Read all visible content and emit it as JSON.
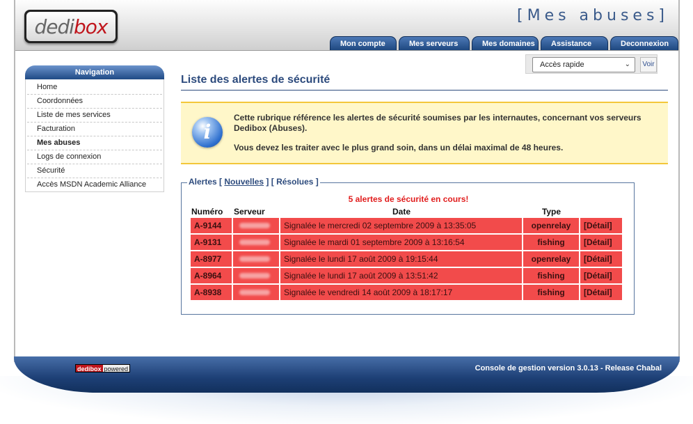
{
  "header": {
    "logo_part1": "dedi",
    "logo_part2": "box",
    "title": "[Mes abuses]"
  },
  "tabs": [
    "Mon compte",
    "Mes serveurs",
    "Mes domaines",
    "Assistance",
    "Deconnexion"
  ],
  "quick_access": {
    "selected": "Accès rapide",
    "button_label": "Voir"
  },
  "navigation": {
    "heading": "Navigation",
    "items": [
      "Home",
      "Coordonnées",
      "Liste de mes services",
      "Facturation",
      "Mes abuses",
      "Logs de connexion",
      "Sécurité",
      "Accès MSDN Academic Alliance"
    ],
    "active": "Mes abuses"
  },
  "main": {
    "title": "Liste des alertes de sécurité",
    "info_paragraph1": "Cette rubrique référence les alertes de sécurité soumises par les internautes, concernant vos serveurs Dedibox (Abuses).",
    "info_paragraph2": "Vous devez les traiter avec le plus grand soin, dans un délai maximal de 48 heures."
  },
  "alerts": {
    "legend_prefix": "Alertes [",
    "link_new": "Nouvelles",
    "legend_mid": "] [",
    "link_resolved": "Résolues",
    "legend_suffix": "]",
    "summary": "5 alertes de sécurité en cours!",
    "columns": [
      "Numéro",
      "Serveur",
      "Date",
      "Type"
    ],
    "detail_label": "[Détail]",
    "rows": [
      {
        "id": "A-9144",
        "date": "Signalée le mercredi 02 septembre 2009 à 13:35:05",
        "type": "openrelay"
      },
      {
        "id": "A-9131",
        "date": "Signalée le mardi 01 septembre 2009 à 13:16:54",
        "type": "fishing"
      },
      {
        "id": "A-8977",
        "date": "Signalée le lundi 17 août 2009 à 19:15:44",
        "type": "openrelay"
      },
      {
        "id": "A-8964",
        "date": "Signalée le lundi 17 août 2009 à 13:51:42",
        "type": "fishing"
      },
      {
        "id": "A-8938",
        "date": "Signalée le vendredi 14 août 2009 à 18:17:17",
        "type": "fishing"
      }
    ]
  },
  "footer": {
    "badge_part1": "dedibox",
    "badge_part2": "powered",
    "version": "Console de gestion version 3.0.13 - Release Chabal"
  },
  "colors": {
    "accent": "#2d4b7d",
    "tab": "#1e4880",
    "alert_row": "#f24b4b",
    "alert_text": "#e11d1d",
    "info_bg": "#fff7c9"
  }
}
